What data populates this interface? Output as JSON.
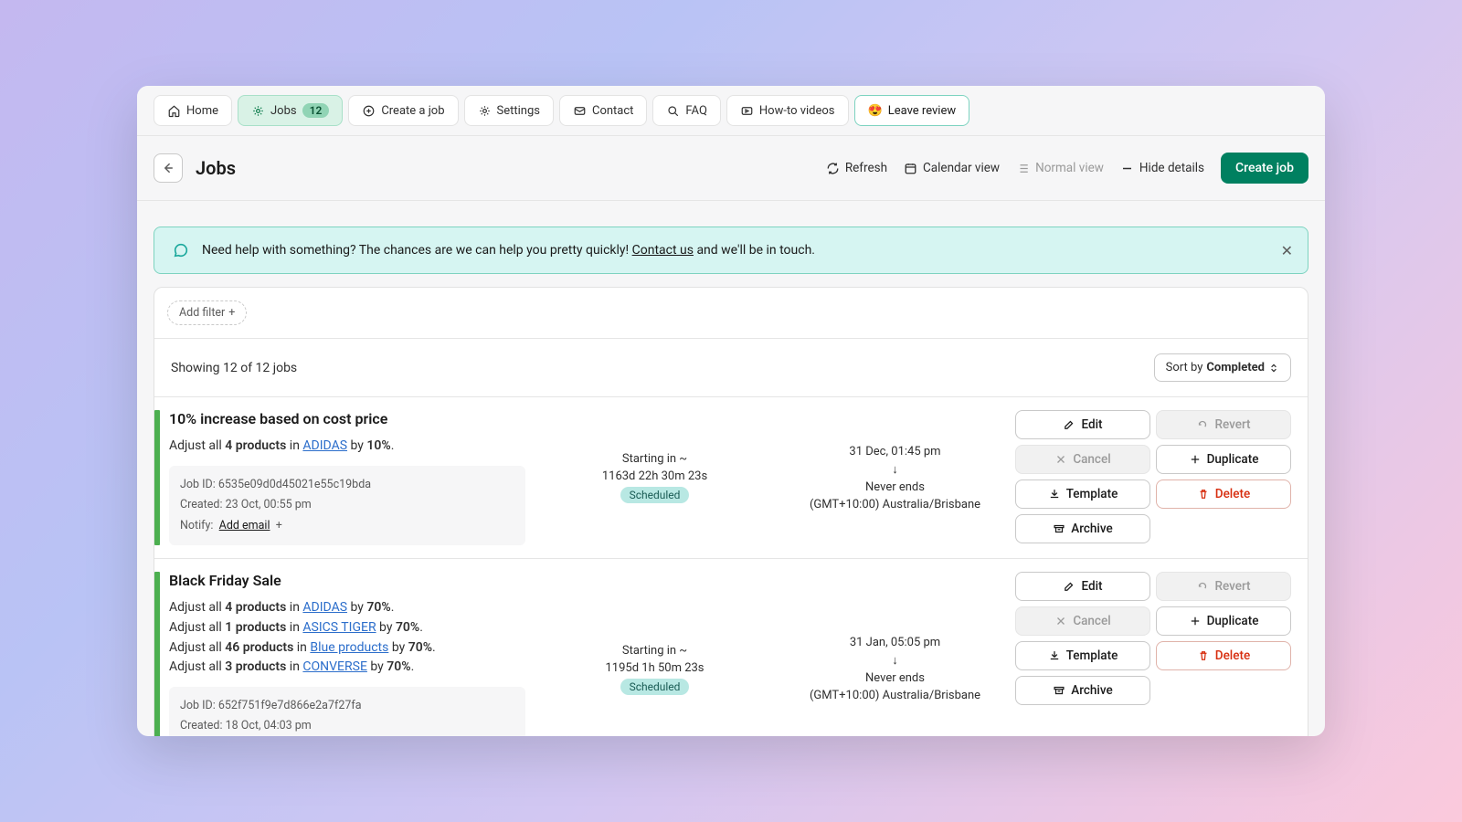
{
  "tabs": {
    "home": "Home",
    "jobs": "Jobs",
    "jobs_count": "12",
    "create": "Create a job",
    "settings": "Settings",
    "contact": "Contact",
    "faq": "FAQ",
    "howto": "How-to videos",
    "review": "Leave review"
  },
  "header": {
    "title": "Jobs",
    "refresh": "Refresh",
    "calendar": "Calendar view",
    "normal": "Normal view",
    "hide": "Hide details",
    "create": "Create job"
  },
  "banner": {
    "pre": "Need help with something? The chances are we can help you pretty quickly! ",
    "link": "Contact us",
    "post": " and we'll be in touch."
  },
  "filter": {
    "add": "Add filter"
  },
  "summary": "Showing 12 of 12 jobs",
  "sort": {
    "label": "Sort by ",
    "value": "Completed"
  },
  "buttons": {
    "edit": "Edit",
    "revert": "Revert",
    "cancel": "Cancel",
    "duplicate": "Duplicate",
    "template": "Template",
    "delete": "Delete",
    "archive": "Archive"
  },
  "jobs": [
    {
      "title": "10% increase based on cost price",
      "lines": [
        {
          "pre": "Adjust all ",
          "count": "4 products",
          "mid": " in ",
          "link": "ADIDAS",
          "post": " by ",
          "pct": "10%"
        }
      ],
      "id": "6535e09d0d45021e55c19bda",
      "created": "23 Oct, 00:55 pm",
      "starting_pre": "Starting in ~",
      "starting": "1163d 22h 30m 23s",
      "status": "Scheduled",
      "dt": "31 Dec, 01:45 pm",
      "ends": "Never ends",
      "tz": "(GMT+10:00) Australia/Brisbane"
    },
    {
      "title": "Black Friday Sale",
      "lines": [
        {
          "pre": "Adjust all ",
          "count": "4 products",
          "mid": " in ",
          "link": "ADIDAS",
          "post": " by ",
          "pct": "70%"
        },
        {
          "pre": "Adjust all ",
          "count": "1 products",
          "mid": " in ",
          "link": "ASICS TIGER",
          "post": " by ",
          "pct": "70%"
        },
        {
          "pre": "Adjust all ",
          "count": "46 products",
          "mid": " in ",
          "link": "Blue products",
          "post": " by ",
          "pct": "70%"
        },
        {
          "pre": "Adjust all ",
          "count": "3 products",
          "mid": " in ",
          "link": "CONVERSE",
          "post": " by ",
          "pct": "70%"
        }
      ],
      "id": "652f751f9e7d866e2a7f27fa",
      "created": "18 Oct, 04:03 pm",
      "starting_pre": "Starting in ~",
      "starting": "1195d 1h 50m 23s",
      "status": "Scheduled",
      "dt": "31 Jan, 05:05 pm",
      "ends": "Never ends",
      "tz": "(GMT+10:00) Australia/Brisbane"
    }
  ],
  "meta_labels": {
    "jobid": "Job ID: ",
    "created": "Created: ",
    "notify": "Notify:",
    "addemail": "Add email"
  }
}
